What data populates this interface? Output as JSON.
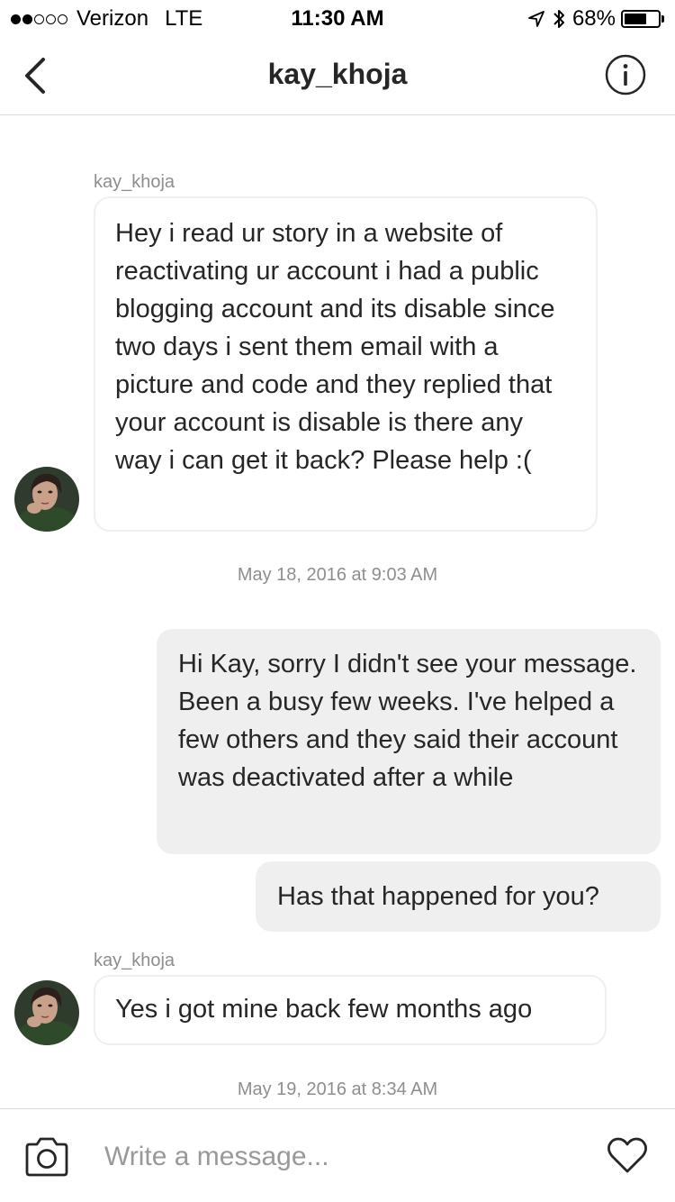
{
  "status_bar": {
    "carrier": "Verizon",
    "network": "LTE",
    "time": "11:30 AM",
    "battery_percent": "68%",
    "battery_level": 0.68,
    "signal_bars_filled": 2,
    "signal_bars_total": 5,
    "icons": [
      "location-arrow-icon",
      "bluetooth-icon",
      "battery-icon"
    ]
  },
  "header": {
    "title": "kay_khoja",
    "back_icon": "chevron-left-icon",
    "info_icon": "info-circle-icon"
  },
  "thread": {
    "messages": [
      {
        "direction": "incoming",
        "sender": "kay_khoja",
        "text": "Hey i read ur story in a website of reactivating ur account i had a public blogging account and its disable since two days i sent them email with a picture and code and they replied that your account is disable is there any way i can get it back? Please help :("
      },
      {
        "type": "timestamp",
        "text": "May 18, 2016 at 9:03 AM"
      },
      {
        "direction": "outgoing",
        "text": "Hi Kay, sorry I didn't see your message. Been a busy few weeks. I've helped a few others and they said their account was deactivated after a while"
      },
      {
        "direction": "outgoing",
        "text": "Has that happened for you?"
      },
      {
        "direction": "incoming",
        "sender": "kay_khoja",
        "text": "Yes i got mine back few months ago"
      },
      {
        "type": "timestamp",
        "text": "May 19, 2016 at 8:34 AM"
      }
    ]
  },
  "composer": {
    "placeholder": "Write a message...",
    "value": "",
    "camera_icon": "camera-icon",
    "like_icon": "heart-icon"
  },
  "colors": {
    "incoming_bubble_border": "#efefef",
    "outgoing_bubble_bg": "#efefef",
    "text": "#262626",
    "meta_text": "#8e8e8e",
    "divider": "#dbdbdb"
  }
}
